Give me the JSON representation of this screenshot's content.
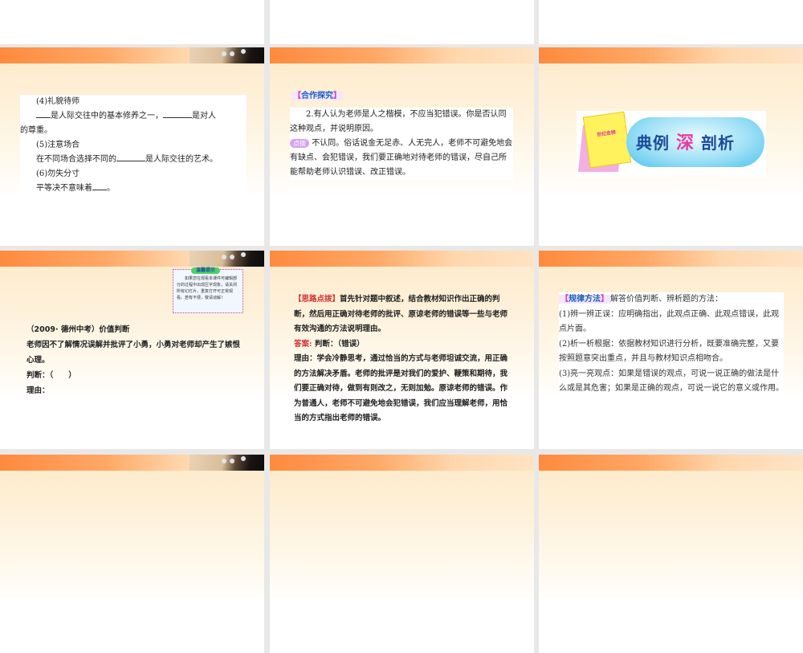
{
  "slides": {
    "s1": {
      "heading4": "(4)礼貌待师",
      "line4a": "是人际交往中的基本修养之一，",
      "line4b": "是对人",
      "line4c": "的尊重。",
      "heading5": "(5)注意场合",
      "line5a": "在不同场合选择不同的",
      "line5b": "是人际交往的艺术。",
      "heading6": "(6)勿失分寸",
      "line6a": "平等决不意味着",
      "line6b": "。"
    },
    "s2": {
      "tag": "合作探究",
      "question": "2.有人认为老师是人之楷模，不应当犯错误。你是否认同这种观点，并说明原因。",
      "badge": "点拨",
      "answer": "不认同。俗话说金无足赤、人无完人，老师不可避免地会有缺点、会犯错误，我们要正确地对待老师的错误，尽自己所能帮助老师认识错误、改正错误。"
    },
    "s3": {
      "book_text": "世纪金榜",
      "title_a": "典例",
      "title_b": "深",
      "title_c": "剖析"
    },
    "s4": {
      "tip_title": "温馨提示",
      "tip_body": "如果您在观看本课件可编辑部分的过程中出现压字现象，请关闭所有幻灯片，重复打开可正常观看。若有不便，敬请谅解！",
      "source": "（2009· 德州中考）价值判断",
      "question": "老师因不了解情况误解并批评了小勇，小勇对老师却产生了嫉恨心理。",
      "judge": "判断：（　　）",
      "reason": "理由："
    },
    "s5": {
      "hint_label": "【思路点拨】",
      "hint": "首先针对题中叙述，结合教材知识作出正确的判断，然后用正确对待老师的批评、原谅老师的错误等一些与老师有效沟通的方法说明理由。",
      "answer_label": "答案:",
      "answer_judge": "判断：（错误）",
      "answer_reason": "理由：学会冷静思考，通过恰当的方式与老师坦诚交流，用正确的方法解决矛盾。老师的批评是对我们的爱护、鞭策和期待，我们要正确对待，做到有则改之，无则加勉。原谅老师的错误。作为普通人，老师不可避免地会犯错误，我们应当理解老师，用恰当的方式指出老师的错误。"
    },
    "s6": {
      "tag": "规律方法",
      "intro": "解答价值判断、辨析题的方法：",
      "item1": "(1)辨一辨正误：应明确指出，此观点正确、此观点错误，此观点片面。",
      "item2": "(2)析一析根据：依据教材知识进行分析，既要准确完整，又要按照题意突出重点，并且与教材知识点相吻合。",
      "item3": "(3)亮一亮观点：如果是错误的观点，可说一说正确的做法是什么或是其危害；如果是正确的观点，可说一说它的意义或作用。"
    }
  }
}
